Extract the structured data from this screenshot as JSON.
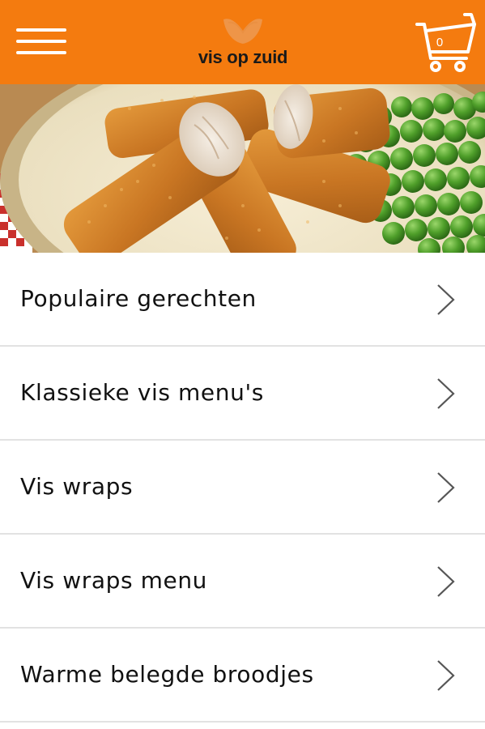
{
  "header": {
    "menu_icon": "hamburger-menu-icon",
    "logo_text": "vis op zuid",
    "cart_icon": "shopping-cart-icon",
    "cart_count": "0",
    "background_color": "#f47b0f"
  },
  "hero": {
    "image": "fried-fish-sticks-with-peas-photo"
  },
  "menu": {
    "chevron_icon": "chevron-right-icon",
    "items": [
      {
        "label": "Populaire gerechten"
      },
      {
        "label": "Klassieke vis menu's"
      },
      {
        "label": "Vis wraps"
      },
      {
        "label": "Vis wraps menu"
      },
      {
        "label": "Warme belegde broodjes"
      }
    ]
  }
}
